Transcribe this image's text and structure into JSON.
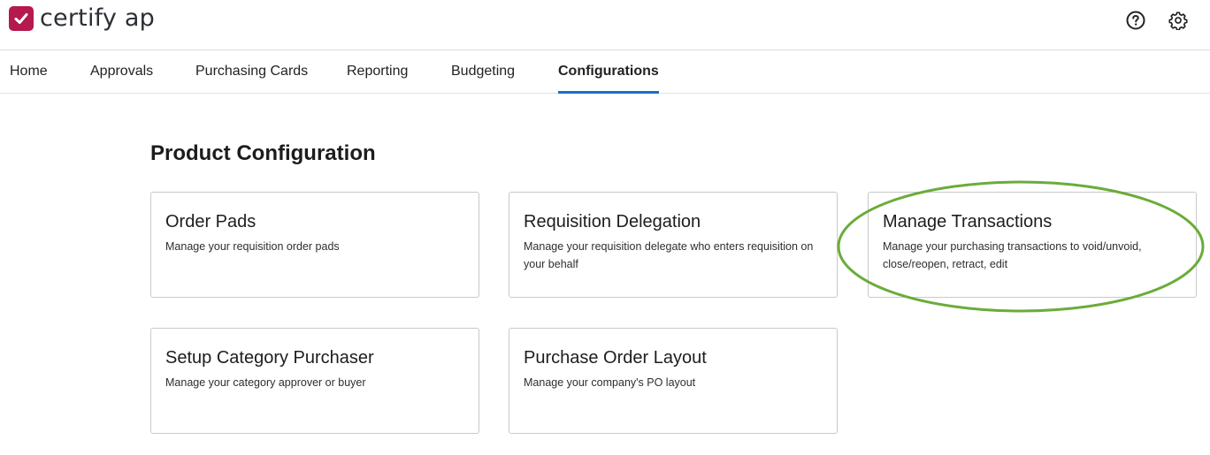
{
  "app": {
    "name": "certify ap"
  },
  "header": {
    "help_icon": "question-circle-icon",
    "settings_icon": "gear-icon"
  },
  "nav": {
    "tabs": [
      {
        "label": "Home"
      },
      {
        "label": "Approvals"
      },
      {
        "label": "Purchasing Cards"
      },
      {
        "label": "Reporting"
      },
      {
        "label": "Budgeting"
      },
      {
        "label": "Configurations",
        "active": true
      }
    ]
  },
  "main": {
    "title": "Product Configuration",
    "cards": [
      {
        "title": "Order Pads",
        "description": "Manage your requisition order pads"
      },
      {
        "title": "Requisition Delegation",
        "description": "Manage your requisition delegate who enters requisition on your behalf"
      },
      {
        "title": "Manage Transactions",
        "description": "Manage your purchasing transactions to void/unvoid, close/reopen, retract, edit"
      },
      {
        "title": "Setup Category Purchaser",
        "description": "Manage your category approver or buyer"
      },
      {
        "title": "Purchase Order Layout",
        "description": "Manage your company's PO layout"
      }
    ]
  },
  "colors": {
    "brand": "#b5194e",
    "active_tab": "#1a6fbf",
    "highlight": "#6aac3a"
  }
}
